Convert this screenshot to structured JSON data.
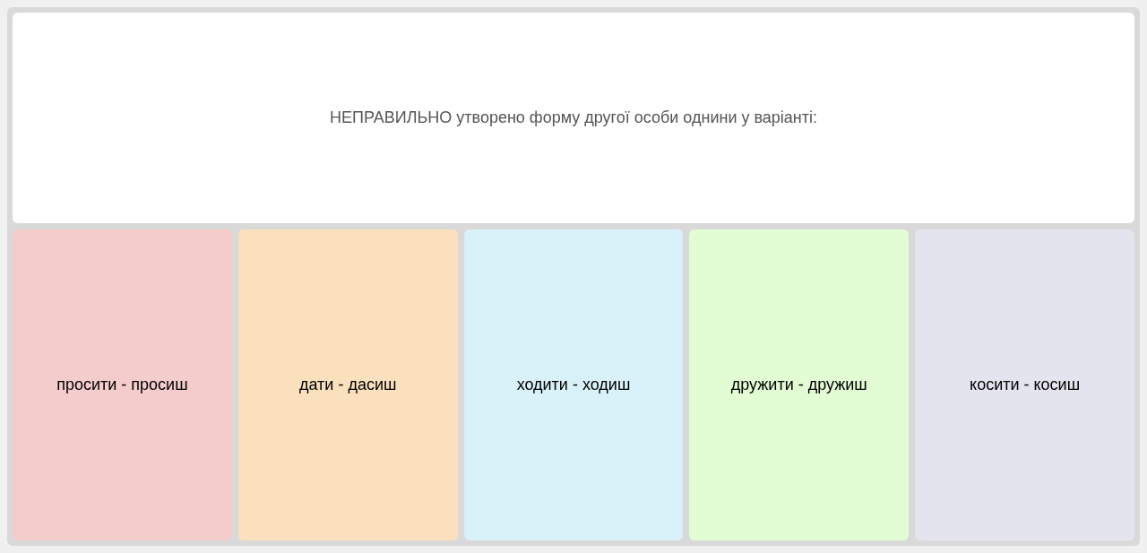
{
  "question": "НЕПРАВИЛЬНО утворено форму другої особи однини у варіанті:",
  "options": [
    {
      "label": "просити - просиш",
      "color": "#f4cccc"
    },
    {
      "label": "дати - дасиш",
      "color": "#fae0bd"
    },
    {
      "label": "ходити - ходиш",
      "color": "#d9f1f8"
    },
    {
      "label": "дружити - дружиш",
      "color": "#e2fcd4"
    },
    {
      "label": "косити - косиш",
      "color": "#e4e4ef"
    }
  ]
}
